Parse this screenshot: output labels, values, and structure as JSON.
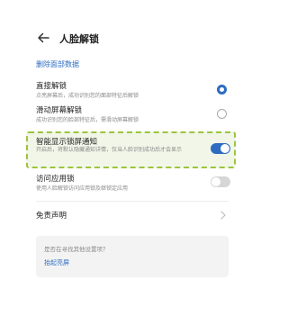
{
  "header": {
    "title": "人脸解锁"
  },
  "delete_link": "删除面部数据",
  "settings": [
    {
      "title": "直接解锁",
      "subtitle": "点亮屏幕后，成功识别您的面部特征后解锁",
      "control": "radio",
      "state": "selected"
    },
    {
      "title": "滑动屏幕解锁",
      "subtitle": "成功识别您的脸部特征后，需滑动屏幕解锁",
      "control": "radio",
      "state": "unselected"
    },
    {
      "title": "智能显示锁屏通知",
      "subtitle": "开启后，将默认隐藏通知详情，仅当人脸识别成功后才会显示",
      "control": "toggle",
      "state": "on",
      "highlighted": true
    },
    {
      "title": "访问应用锁",
      "subtitle": "使用人脸解锁访问应用锁及继锁定应用",
      "control": "toggle",
      "state": "off"
    }
  ],
  "disclaimer": "免责声明",
  "help": {
    "question": "是否在寻找其他设置项？",
    "link": "抬起亮屏"
  },
  "colors": {
    "accent": "#2d6cc0",
    "highlight_border": "#9bc53d",
    "card_bg": "#f3f3f3"
  },
  "icons": {
    "back": "arrow-left",
    "chevron": "chevron-right"
  }
}
